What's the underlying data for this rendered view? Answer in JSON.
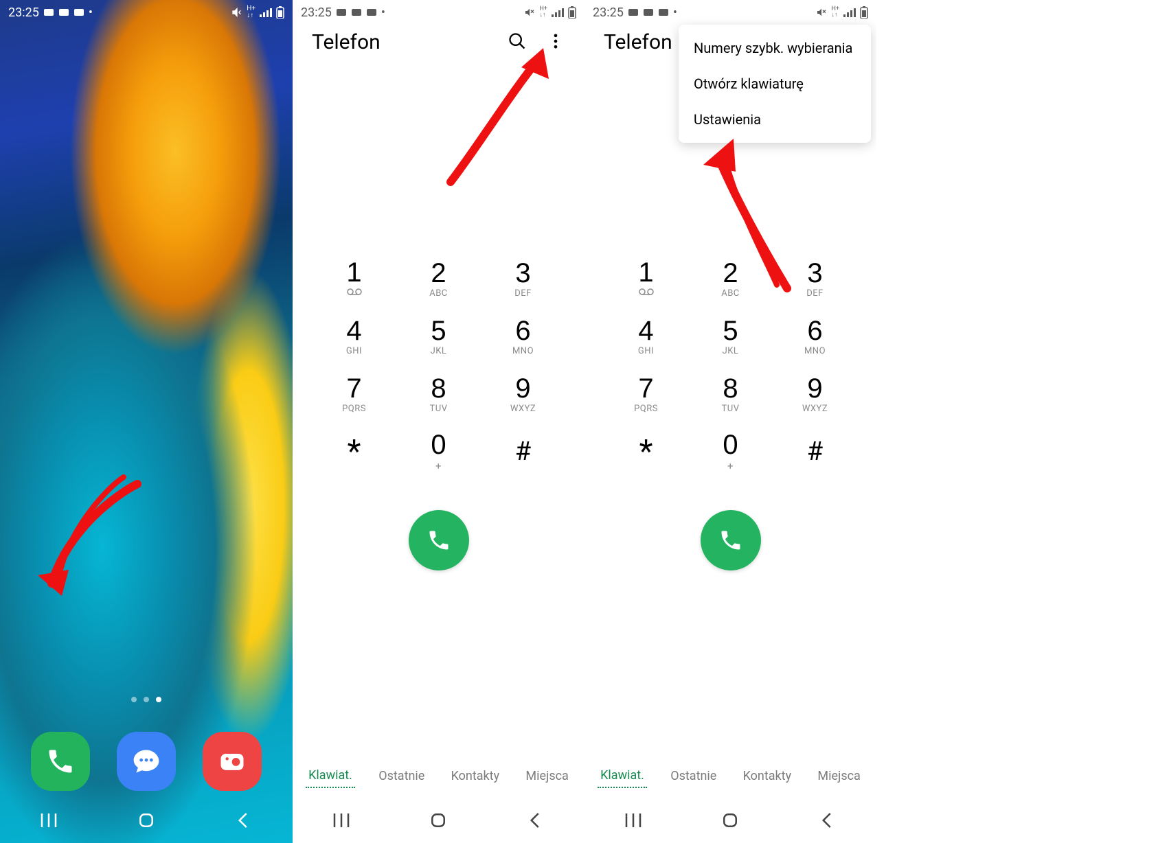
{
  "status": {
    "time": "23:25"
  },
  "screen1": {
    "dock": {
      "phone_label": "Phone",
      "messages_label": "Messages",
      "camera_label": "Camera"
    }
  },
  "dialer": {
    "title": "Telefon",
    "tabs": {
      "keypad": "Klawiat.",
      "recent": "Ostatnie",
      "contacts": "Kontakty",
      "places": "Miejsca"
    },
    "keys": [
      {
        "n": "1",
        "s": ""
      },
      {
        "n": "2",
        "s": "ABC"
      },
      {
        "n": "3",
        "s": "DEF"
      },
      {
        "n": "4",
        "s": "GHI"
      },
      {
        "n": "5",
        "s": "JKL"
      },
      {
        "n": "6",
        "s": "MNO"
      },
      {
        "n": "7",
        "s": "PQRS"
      },
      {
        "n": "8",
        "s": "TUV"
      },
      {
        "n": "9",
        "s": "WXYZ"
      },
      {
        "n": "*",
        "s": ""
      },
      {
        "n": "0",
        "s": "+"
      },
      {
        "n": "#",
        "s": ""
      }
    ]
  },
  "menu": {
    "speed_dial": "Numery szybk. wybierania",
    "open_keyboard": "Otwórz klawiaturę",
    "settings": "Ustawienia"
  }
}
